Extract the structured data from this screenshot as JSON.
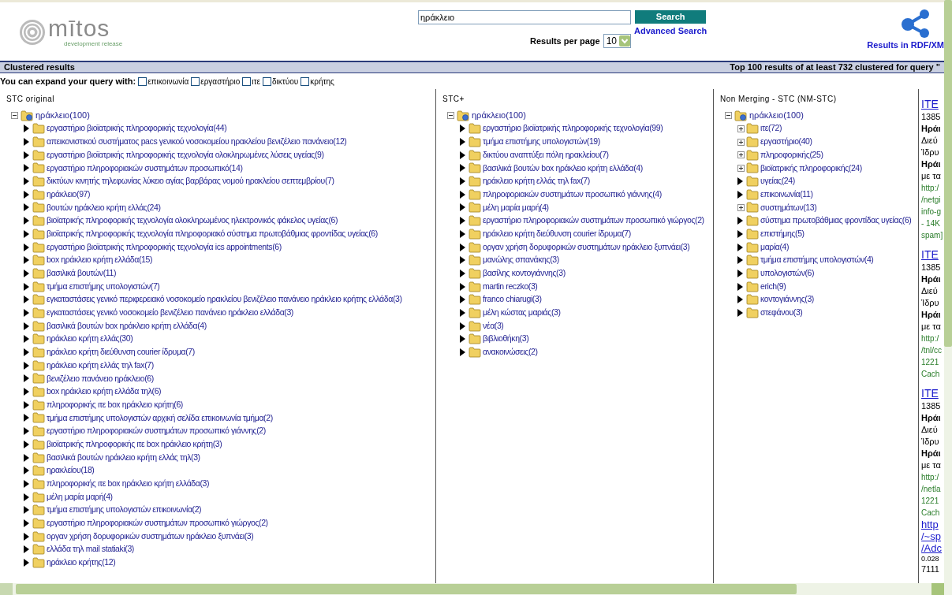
{
  "header": {
    "logo": {
      "name": "mītos",
      "tagline": "development release"
    },
    "search": {
      "value": "ηράκλειο",
      "button": "Search",
      "advanced_link": "Advanced Search",
      "per_page_label": "Results per page",
      "per_page_value": "10"
    },
    "rdf_link": "Results in RDF/XM"
  },
  "bar": {
    "left": "Clustered results",
    "right": "Top 100 results of at least 732 clustered for query \""
  },
  "expand": {
    "label": "You can expand your query with:",
    "options": [
      {
        "label": "επικοινωνία",
        "checked": false
      },
      {
        "label": "εργαστήριο",
        "checked": false
      },
      {
        "label": "ιτε",
        "checked": false
      },
      {
        "label": "δικτύου",
        "checked": false
      },
      {
        "label": "κρήτης",
        "checked": false
      }
    ]
  },
  "columns": [
    {
      "title": "STC original",
      "root": {
        "label": "ηράκλειο(100)",
        "expanded": true,
        "children": [
          {
            "label": "εργαστήριο βιοϊατρικής πληροφορικής τεχνολογία(44)",
            "kind": "arrow"
          },
          {
            "label": "απεικονιστικού συστήματος pacs γενικού νοσοκομείου ηρακλείου βενιζέλειο πανάνειο(12)",
            "kind": "arrow"
          },
          {
            "label": "εργαστήριο βιοϊατρικής πληροφορικής τεχνολογία ολοκληρωμένες λύσεις υγείας(9)",
            "kind": "arrow"
          },
          {
            "label": "εργαστήριο πληροφοριακών συστημάτων προσωπικό(14)",
            "kind": "arrow"
          },
          {
            "label": "δικτύων κινητής τηλεφωνίας λύκειο αγίας βαρβάρας νομού ηρακλείου σεπτεμβρίου(7)",
            "kind": "arrow"
          },
          {
            "label": "ηράκλειο(97)",
            "kind": "arrow"
          },
          {
            "label": "βουτών ηράκλειο κρήτη ελλάς(24)",
            "kind": "arrow"
          },
          {
            "label": "βιοϊατρικής πληροφορικής τεχνολογία ολοκληρωμένος ηλεκτρονικός φάκελος υγείας(6)",
            "kind": "arrow"
          },
          {
            "label": "βιοϊατρικής πληροφορικής τεχνολογία πληροφοριακό σύστημα πρωτοβάθμιας φροντίδας υγείας(6)",
            "kind": "arrow"
          },
          {
            "label": "εργαστήριο βιοϊατρικής πληροφορικής τεχνολογία ics appointments(6)",
            "kind": "arrow"
          },
          {
            "label": "box ηράκλειο κρήτη ελλάδα(15)",
            "kind": "arrow"
          },
          {
            "label": "βασιλικά βουτών(11)",
            "kind": "arrow"
          },
          {
            "label": "τμήμα επιστήμης υπολογιστών(7)",
            "kind": "arrow"
          },
          {
            "label": "εγκαταστάσεις γενικό περιφερειακό νοσοκομείο ηρακλείου βενιζέλειο πανάνειο ηράκλειο κρήτης ελλάδα(3)",
            "kind": "arrow"
          },
          {
            "label": "εγκαταστάσεις γενικό νοσοκομείο βενιζέλειο πανάνειο ηράκλειο ελλάδα(3)",
            "kind": "arrow"
          },
          {
            "label": "βασιλικά βουτών box ηράκλειο κρήτη ελλάδα(4)",
            "kind": "arrow"
          },
          {
            "label": "ηράκλειο κρήτη ελλάς(30)",
            "kind": "arrow"
          },
          {
            "label": "ηράκλειο κρήτη διεύθυνση courier ίδρυμα(7)",
            "kind": "arrow"
          },
          {
            "label": "ηράκλειο κρήτη ελλάς τηλ fax(7)",
            "kind": "arrow"
          },
          {
            "label": "βενιζέλειο πανάνειο ηράκλειο(6)",
            "kind": "arrow"
          },
          {
            "label": "box ηράκλειο κρήτη ελλάδα τηλ(6)",
            "kind": "arrow"
          },
          {
            "label": "πληροφορικής ιτε box ηράκλειο κρήτη(6)",
            "kind": "arrow"
          },
          {
            "label": "τμήμα επιστήμης υπολογιστών αρχική σελίδα επικοινωνία τμήμα(2)",
            "kind": "arrow"
          },
          {
            "label": "εργαστήριο πληροφοριακών συστημάτων προσωπικό γιάννης(2)",
            "kind": "arrow"
          },
          {
            "label": "βιοϊατρικής πληροφορικής ιτε box ηράκλειο κρήτη(3)",
            "kind": "arrow"
          },
          {
            "label": "βασιλικά βουτών ηράκλειο κρήτη ελλάς τηλ(3)",
            "kind": "arrow"
          },
          {
            "label": "ηρακλείου(18)",
            "kind": "arrow"
          },
          {
            "label": "πληροφορικής ιτε box ηράκλειο κρήτη ελλάδα(3)",
            "kind": "arrow"
          },
          {
            "label": "μέλη μαρία μαρή(4)",
            "kind": "arrow"
          },
          {
            "label": "τμήμα επιστήμης υπολογιστών επικοινωνία(2)",
            "kind": "arrow"
          },
          {
            "label": "εργαστήριο πληροφοριακών συστημάτων προσωπικό γιώργος(2)",
            "kind": "arrow"
          },
          {
            "label": "οργαν χρήση δορυφορικών συστημάτων ηράκλειο ξυπνάει(3)",
            "kind": "arrow"
          },
          {
            "label": "ελλάδα τηλ mail statiaki(3)",
            "kind": "arrow"
          },
          {
            "label": "ηράκλειο κρήτης(12)",
            "kind": "arrow"
          }
        ]
      }
    },
    {
      "title": "STC+",
      "root": {
        "label": "ηράκλειο(100)",
        "expanded": true,
        "children": [
          {
            "label": "εργαστήριο βιοϊατρικής πληροφορικής τεχνολογία(99)",
            "kind": "arrow"
          },
          {
            "label": "τμήμα επιστήμης υπολογιστών(19)",
            "kind": "arrow"
          },
          {
            "label": "δικτύου αναπτύξει πόλη ηρακλείου(7)",
            "kind": "arrow"
          },
          {
            "label": "βασιλικά βουτών box ηράκλειο κρήτη ελλάδα(4)",
            "kind": "arrow"
          },
          {
            "label": "ηράκλειο κρήτη ελλάς τηλ fax(7)",
            "kind": "arrow"
          },
          {
            "label": "πληροφοριακών συστημάτων προσωπικό γιάννης(4)",
            "kind": "arrow"
          },
          {
            "label": "μέλη μαρία μαρή(4)",
            "kind": "arrow"
          },
          {
            "label": "εργαστήριο πληροφοριακών συστημάτων προσωπικό γιώργος(2)",
            "kind": "arrow"
          },
          {
            "label": "ηράκλειο κρήτη διεύθυνση courier ίδρυμα(7)",
            "kind": "arrow"
          },
          {
            "label": "οργαν χρήση δορυφορικών συστημάτων ηράκλειο ξυπνάει(3)",
            "kind": "arrow"
          },
          {
            "label": "μανώλης σπανάκης(3)",
            "kind": "arrow"
          },
          {
            "label": "βασίλης κοντογιάννης(3)",
            "kind": "arrow"
          },
          {
            "label": "martin reczko(3)",
            "kind": "arrow"
          },
          {
            "label": "franco chiarugi(3)",
            "kind": "arrow"
          },
          {
            "label": "μέλη κώστας μαριάς(3)",
            "kind": "arrow"
          },
          {
            "label": "νέα(3)",
            "kind": "arrow"
          },
          {
            "label": "βιβλιοθήκη(3)",
            "kind": "arrow"
          },
          {
            "label": "ανακοινώσεις(2)",
            "kind": "arrow"
          }
        ]
      }
    },
    {
      "title": "Non Merging - STC (NM-STC)",
      "root": {
        "label": "ηράκλειο(100)",
        "expanded": true,
        "children": [
          {
            "label": "ιτε(72)",
            "kind": "collapsed"
          },
          {
            "label": "εργαστήριο(40)",
            "kind": "collapsed"
          },
          {
            "label": "πληροφορικής(25)",
            "kind": "collapsed"
          },
          {
            "label": "βιοϊατρικής πληροφορικής(24)",
            "kind": "collapsed"
          },
          {
            "label": "υγείας(24)",
            "kind": "arrow"
          },
          {
            "label": "επικοινωνία(11)",
            "kind": "arrow"
          },
          {
            "label": "συστημάτων(13)",
            "kind": "collapsed"
          },
          {
            "label": "σύστημα πρωτοβάθμιας φροντίδας υγείας(6)",
            "kind": "arrow"
          },
          {
            "label": "επιστήμης(5)",
            "kind": "arrow"
          },
          {
            "label": "μαρία(4)",
            "kind": "arrow"
          },
          {
            "label": "τμήμα επιστήμης υπολογιστών(4)",
            "kind": "arrow"
          },
          {
            "label": "υπολογιστών(6)",
            "kind": "arrow"
          },
          {
            "label": "erich(9)",
            "kind": "arrow"
          },
          {
            "label": "κοντογιάννης(3)",
            "kind": "arrow"
          },
          {
            "label": "στεφάνου(3)",
            "kind": "arrow"
          }
        ]
      }
    }
  ],
  "results": [
    {
      "text": "ITE",
      "kind": "title"
    },
    {
      "text": "1385",
      "kind": "text"
    },
    {
      "text": "Ηράι",
      "kind": "bold"
    },
    {
      "text": "Διεύ",
      "kind": "text"
    },
    {
      "text": "Ίδρυ",
      "kind": "text"
    },
    {
      "text": "Ηράι",
      "kind": "bold"
    },
    {
      "text": "με τα",
      "kind": "text"
    },
    {
      "text": "http:/",
      "kind": "url"
    },
    {
      "text": "/netgi",
      "kind": "url"
    },
    {
      "text": "info-g",
      "kind": "url"
    },
    {
      "text": "- 14K",
      "kind": "url"
    },
    {
      "text": "spam]",
      "kind": "url"
    },
    {
      "text": "ITE",
      "kind": "title"
    },
    {
      "text": "1385",
      "kind": "text"
    },
    {
      "text": "Ηράι",
      "kind": "bold"
    },
    {
      "text": "Διεύ",
      "kind": "text"
    },
    {
      "text": "Ίδρυ",
      "kind": "text"
    },
    {
      "text": "Ηράι",
      "kind": "bold"
    },
    {
      "text": "με τα",
      "kind": "text"
    },
    {
      "text": "http:/",
      "kind": "url"
    },
    {
      "text": "/tnl/cc",
      "kind": "url"
    },
    {
      "text": "1221",
      "kind": "url"
    },
    {
      "text": "Cach",
      "kind": "url"
    },
    {
      "text": "ITE",
      "kind": "title"
    },
    {
      "text": "1385",
      "kind": "text"
    },
    {
      "text": "Ηράι",
      "kind": "bold"
    },
    {
      "text": "Διεύ",
      "kind": "text"
    },
    {
      "text": "Ίδρυ",
      "kind": "text"
    },
    {
      "text": "Ηράι",
      "kind": "bold"
    },
    {
      "text": "με τα",
      "kind": "text"
    },
    {
      "text": "http:/",
      "kind": "url"
    },
    {
      "text": "/netla",
      "kind": "url"
    },
    {
      "text": "1221",
      "kind": "url"
    },
    {
      "text": "Cach",
      "kind": "url"
    },
    {
      "text": "http",
      "kind": "link"
    },
    {
      "text": "/~sp",
      "kind": "link"
    },
    {
      "text": "/Adc",
      "kind": "link"
    },
    {
      "text": "0.028",
      "kind": "small"
    },
    {
      "text": "7111",
      "kind": "text"
    }
  ]
}
